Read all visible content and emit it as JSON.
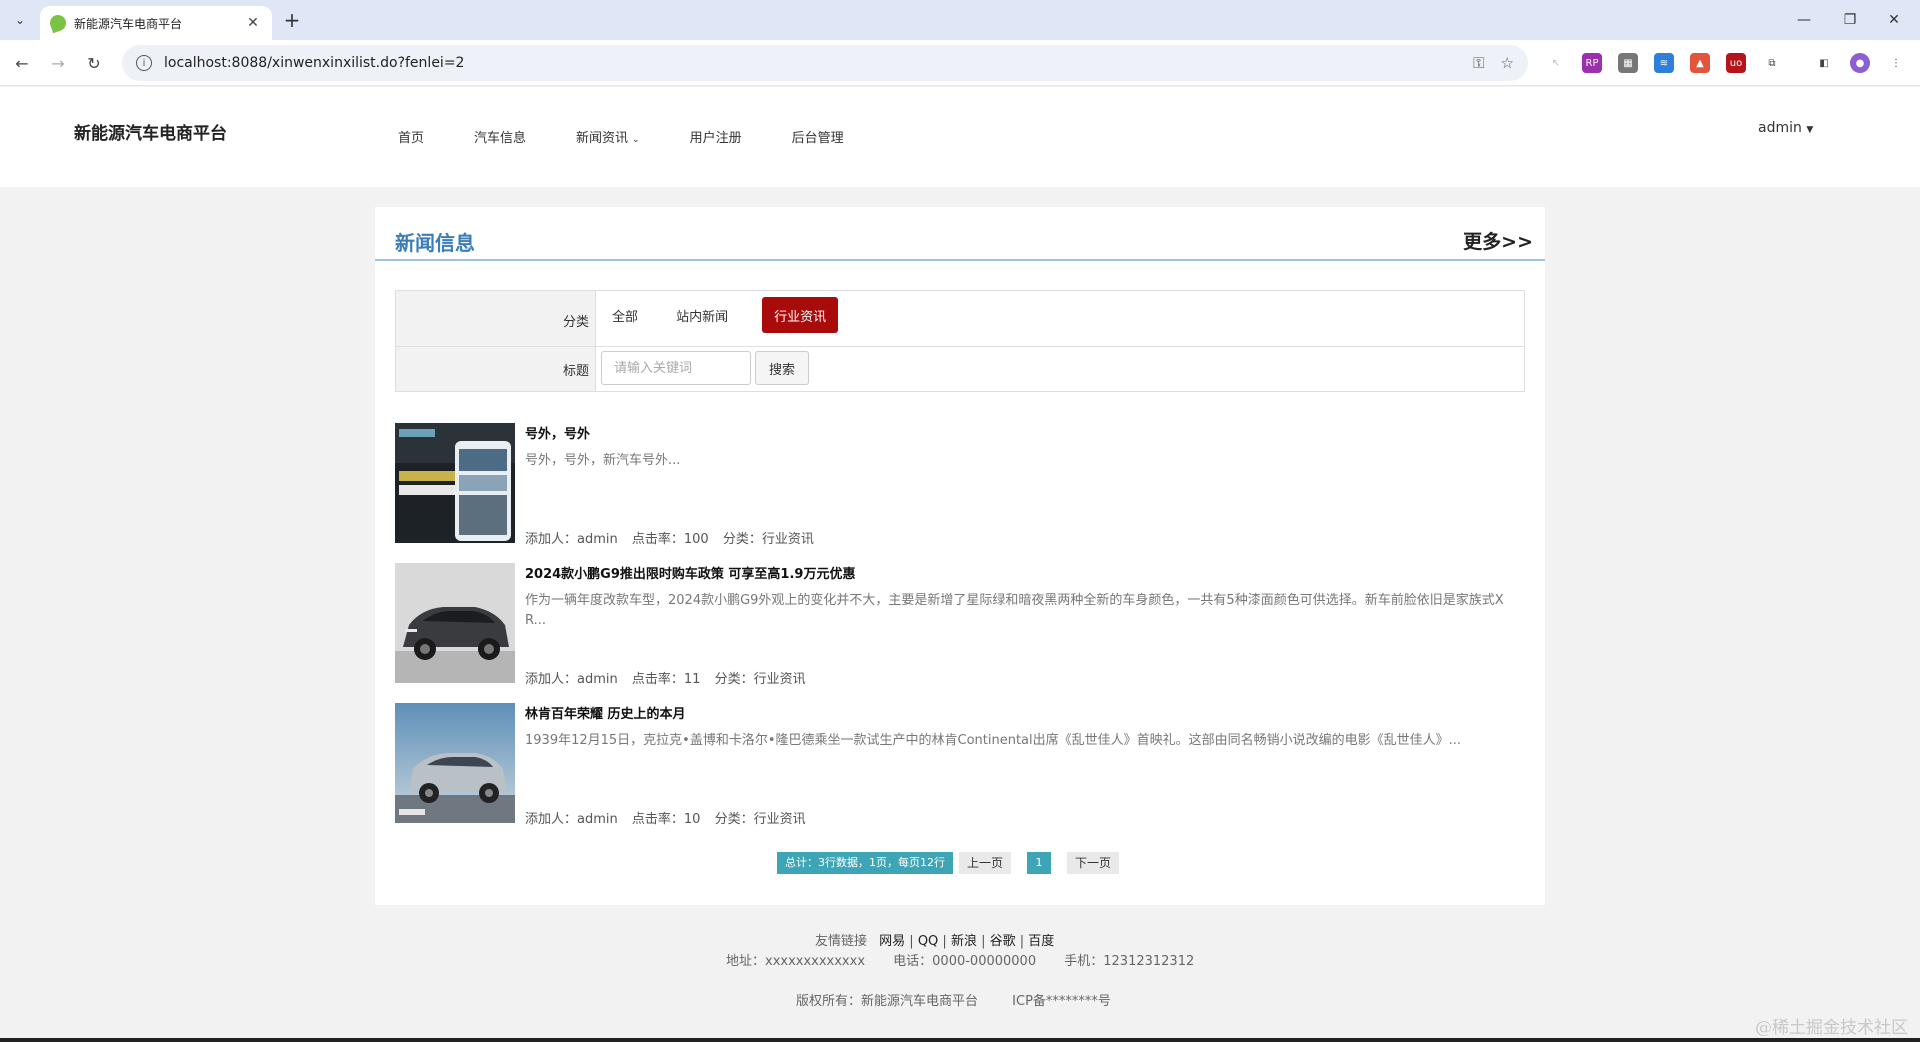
{
  "browser": {
    "tab_title": "新能源汽车电商平台",
    "url": "localhost:8088/xinwenxinxilist.do?fenlei=2"
  },
  "site": {
    "logo": "新能源汽车电商平台",
    "nav": [
      "首页",
      "汽车信息",
      "新闻资讯",
      "用户注册",
      "后台管理"
    ],
    "user": "admin"
  },
  "section": {
    "title": "新闻信息",
    "more": "更多>>"
  },
  "filter": {
    "category_label": "分类",
    "categories": [
      "全部",
      "站内新闻",
      "行业资讯"
    ],
    "active_category": "行业资讯",
    "title_label": "标题",
    "search_placeholder": "请输入关键词",
    "search_button": "搜索"
  },
  "news": [
    {
      "title": "号外，号外",
      "summary": "号外，号外，新汽车号外...",
      "author": "添加人：admin",
      "clicks": "点击率：100",
      "category": "分类：行业资讯",
      "thumb_icon": "app-promo-image"
    },
    {
      "title": "2024款小鹏G9推出限时购车政策 可享至高1.9万元优惠",
      "summary": "作为一辆年度改款车型，2024款小鹏G9外观上的变化并不大，主要是新增了星际绿和暗夜黑两种全新的车身颜色，一共有5种漆面颜色可供选择。新车前脸依旧是家族式X R...",
      "author": "添加人：admin",
      "clicks": "点击率：11",
      "category": "分类：行业资讯",
      "thumb_icon": "suv-photo"
    },
    {
      "title": "林肯百年荣耀 历史上的本月",
      "summary": "1939年12月15日，克拉克•盖博和卡洛尔•隆巴德乘坐一款试生产中的林肯Continental出席《乱世佳人》首映礼。这部由同名畅销小说改编的电影《乱世佳人》...",
      "author": "添加人：admin",
      "clicks": "点击率：10",
      "category": "分类：行业资讯",
      "thumb_icon": "suv-photo"
    }
  ],
  "pager": {
    "total": "总计：3行数据，1页，每页12行",
    "prev": "上一页",
    "current": "1",
    "next": "下一页"
  },
  "footer": {
    "links_label": "友情链接",
    "links": [
      "网易",
      "QQ",
      "新浪",
      "谷歌",
      "百度"
    ],
    "address": "地址：xxxxxxxxxxxxx",
    "phone": "电话：0000-00000000",
    "mobile": "手机：12312312312",
    "copyright": "版权所有：新能源汽车电商平台",
    "icp": "ICP备********号"
  },
  "watermark": "@稀土掘金技术社区",
  "colors": {
    "accent_blue": "#3a7db8",
    "active_red": "#a90a0a",
    "pager_teal": "#3ea5b6"
  }
}
